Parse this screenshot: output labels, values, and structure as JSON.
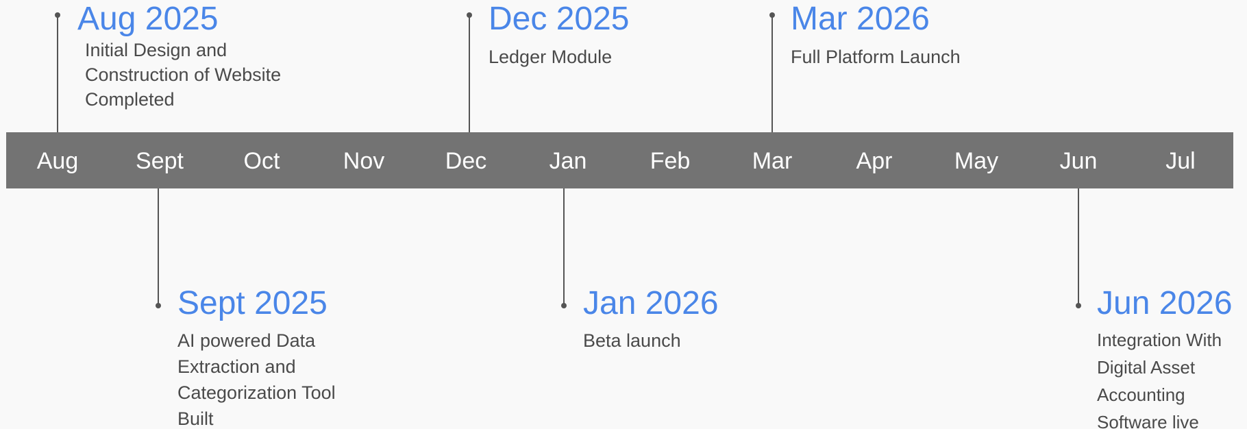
{
  "months": [
    "Aug",
    "Sept",
    "Oct",
    "Nov",
    "Dec",
    "Jan",
    "Feb",
    "Mar",
    "Apr",
    "May",
    "Jun",
    "Jul"
  ],
  "milestones": [
    {
      "date": "Aug 2025",
      "description": "Initial Design and Construction of Website Completed"
    },
    {
      "date": "Sept 2025",
      "description": "AI powered Data Extraction and Categorization Tool Built"
    },
    {
      "date": "Dec 2025",
      "description": "Ledger Module"
    },
    {
      "date": "Jan 2026",
      "description": "Beta launch"
    },
    {
      "date": "Mar 2026",
      "description": "Full Platform Launch"
    },
    {
      "date": "Jun 2026",
      "description": "Integration With Digital Asset Accounting Software live"
    }
  ],
  "colors": {
    "bar": "#737373",
    "date": "#4a86e8",
    "text": "#4a4a4a",
    "stem": "#555555"
  }
}
